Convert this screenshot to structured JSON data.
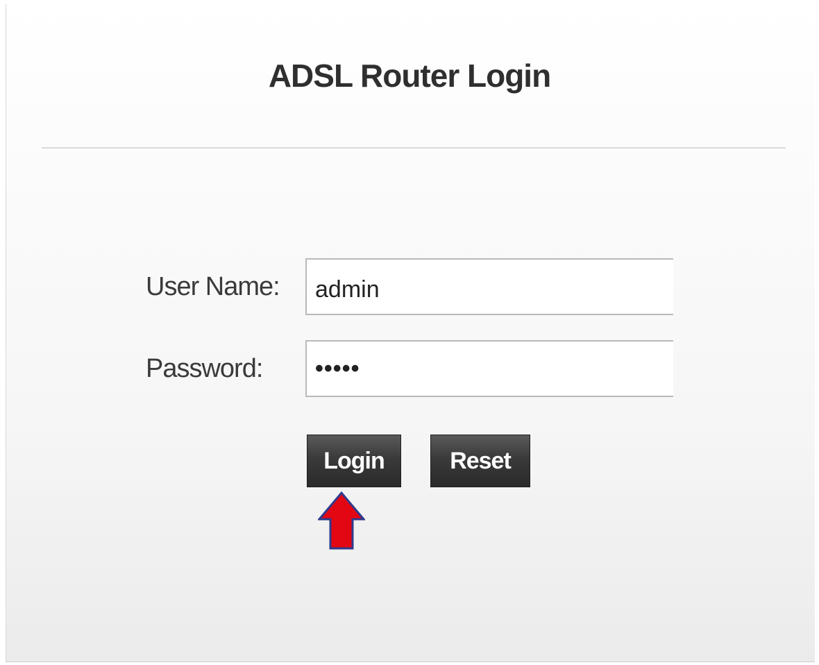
{
  "login": {
    "title": "ADSL Router Login",
    "username_label": "User Name:",
    "username_value": "admin",
    "password_label": "Password:",
    "password_value": "•••••",
    "login_button": "Login",
    "reset_button": "Reset"
  },
  "annotation": {
    "arrow_icon": "up-arrow-icon",
    "arrow_color": "#e30613",
    "arrow_outline": "#2f3b8c"
  }
}
